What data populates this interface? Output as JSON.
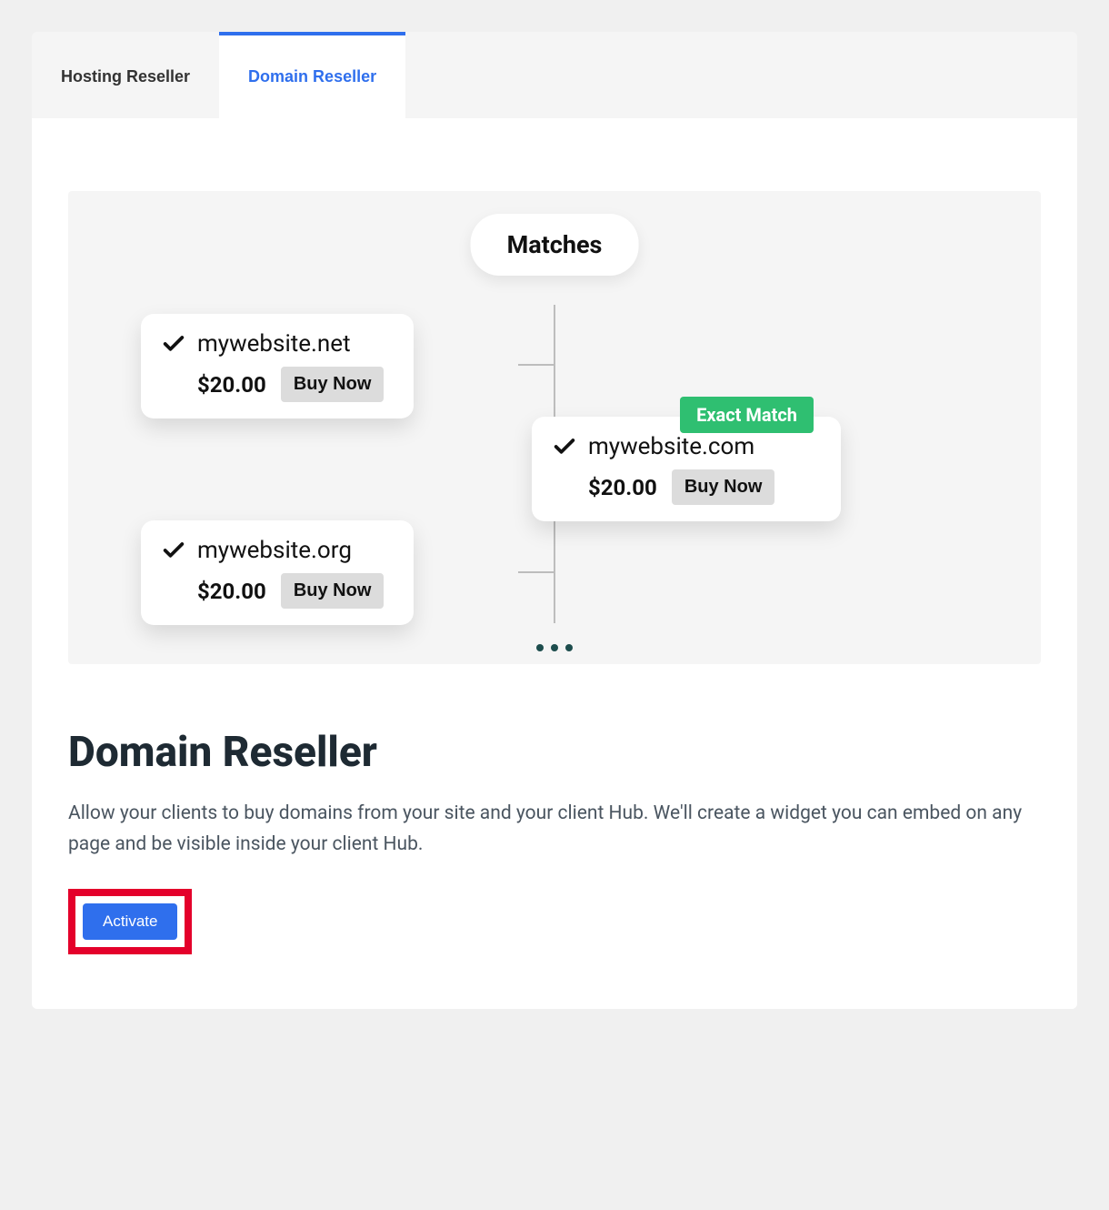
{
  "tabs": [
    {
      "label": "Hosting Reseller",
      "active": false
    },
    {
      "label": "Domain Reseller",
      "active": true
    }
  ],
  "diagram": {
    "matches_label": "Matches",
    "exact_match_label": "Exact Match",
    "buy_label": "Buy Now",
    "domains": {
      "left_top": {
        "name": "mywebsite.net",
        "price": "$20.00"
      },
      "left_bot": {
        "name": "mywebsite.org",
        "price": "$20.00"
      },
      "right": {
        "name": "mywebsite.com",
        "price": "$20.00"
      }
    }
  },
  "section": {
    "title": "Domain Reseller",
    "desc": "Allow your clients to buy domains from your site and your client Hub. We'll create a widget you can embed on any page and be visible inside your client Hub.",
    "activate_label": "Activate"
  }
}
